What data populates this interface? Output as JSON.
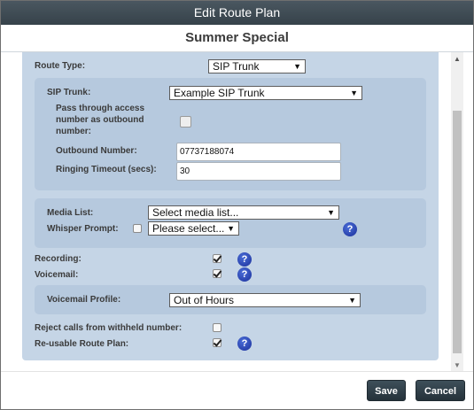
{
  "dialog": {
    "title": "Edit Route Plan",
    "plan_name": "Summer Special"
  },
  "route_type": {
    "label": "Route Type:",
    "value": "SIP Trunk"
  },
  "sip": {
    "trunk_label": "SIP Trunk:",
    "trunk_value": "Example SIP Trunk",
    "pass_through_label_1": "Pass through access",
    "pass_through_label_2": "number as outbound",
    "pass_through_label_3": "number:",
    "outbound_label": "Outbound Number:",
    "outbound_value": "07737188074",
    "ringing_label": "Ringing Timeout (secs):",
    "ringing_value": "30"
  },
  "media": {
    "media_list_label": "Media List:",
    "media_list_value": "Select media list...",
    "whisper_label": "Whisper Prompt:",
    "whisper_value": "Please select..."
  },
  "options": {
    "recording_label": "Recording:",
    "voicemail_label": "Voicemail:",
    "voicemail_profile_label": "Voicemail Profile:",
    "voicemail_profile_value": "Out of Hours",
    "reject_label": "Reject calls from withheld number:",
    "reusable_label": "Re-usable Route Plan:"
  },
  "icons": {
    "help": "help-icon",
    "dropdown": "dropdown-arrow-icon",
    "check": "checkmark-icon"
  },
  "help_glyph": "?",
  "arrow_glyph": "▼",
  "buttons": {
    "save": "Save",
    "cancel": "Cancel"
  }
}
